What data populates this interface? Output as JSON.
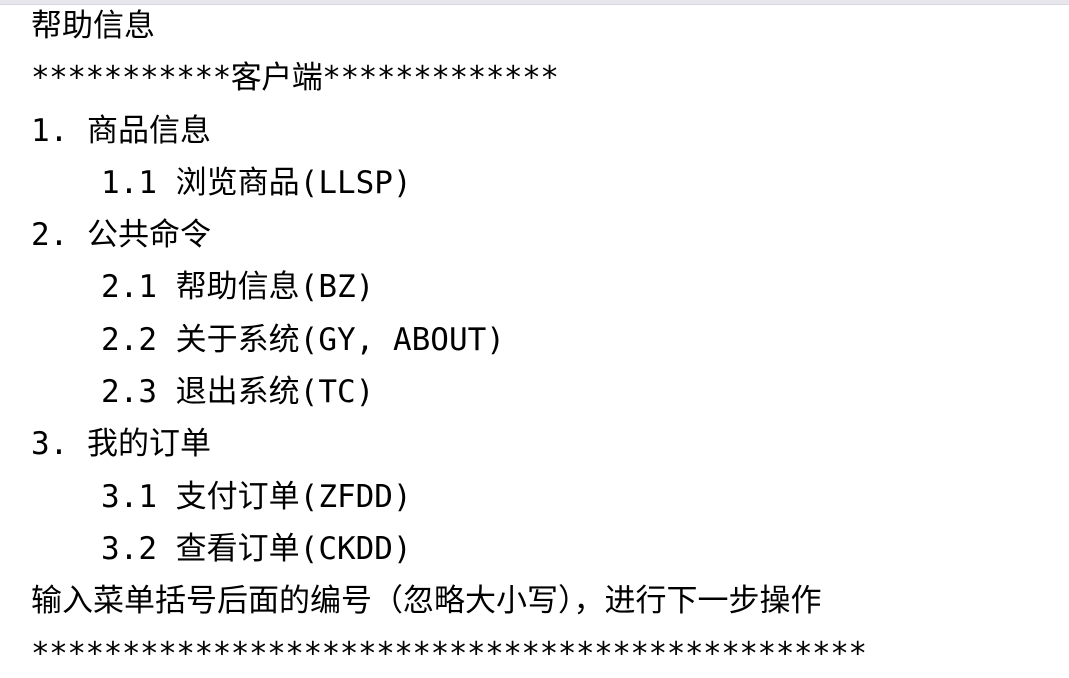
{
  "console": {
    "lines": [
      {
        "text": "帮助信息",
        "indent": false
      },
      {
        "text": "***********客户端*************",
        "indent": false
      },
      {
        "text": "1. 商品信息",
        "indent": false
      },
      {
        "text": "1.1 浏览商品(LLSP)",
        "indent": true
      },
      {
        "text": "2. 公共命令",
        "indent": false
      },
      {
        "text": "2.1 帮助信息(BZ)",
        "indent": true
      },
      {
        "text": "2.2 关于系统(GY, ABOUT)",
        "indent": true
      },
      {
        "text": "2.3 退出系统(TC)",
        "indent": true
      },
      {
        "text": "3. 我的订单",
        "indent": false
      },
      {
        "text": "3.1 支付订单(ZFDD)",
        "indent": true
      },
      {
        "text": "3.2 查看订单(CKDD)",
        "indent": true
      },
      {
        "text": "输入菜单括号后面的编号（忽略大小写），进行下一步操作",
        "indent": false
      },
      {
        "text": "**********************************************",
        "indent": false
      }
    ]
  }
}
